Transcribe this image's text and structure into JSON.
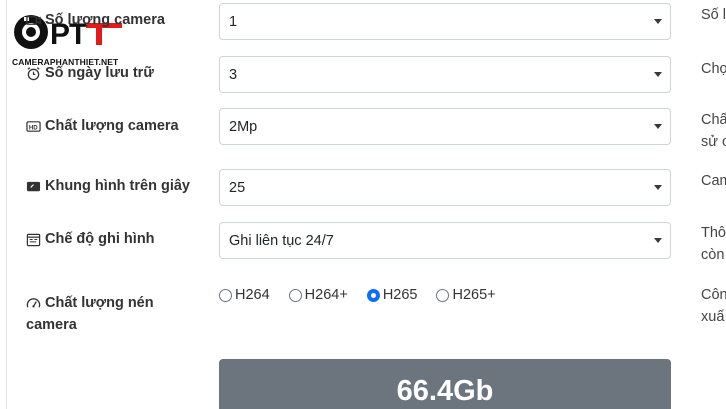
{
  "brand": {
    "logo_text": "OPT",
    "site_name": "CAMERAPHANTHIET.NET",
    "accent_color": "#e01b1b"
  },
  "form": {
    "camera_count": {
      "label": "Số lượng camera",
      "icon": "camera-icon",
      "value": "1",
      "desc": "Số l"
    },
    "storage_days": {
      "label": "Số ngày lưu trữ",
      "icon": "alarm-clock-icon",
      "value": "3",
      "desc": "Chọ"
    },
    "camera_quality": {
      "label": "Chất lượng camera",
      "icon": "hd-icon",
      "value": "2Mp",
      "desc_line1": "Chấ",
      "desc_line2": "sử c"
    },
    "frame_rate": {
      "label": "Khung hình trên giây",
      "icon": "video-frame-icon",
      "value": "25",
      "desc": "Cam"
    },
    "record_mode": {
      "label": "Chế độ ghi hình",
      "icon": "calendar-icon",
      "value": "Ghi liên tục 24/7",
      "desc_line1": "Thô",
      "desc_line2": "còn"
    },
    "compression": {
      "label_line1": "Chất lượng nén",
      "label_line2": "camera",
      "icon": "speedometer-icon",
      "options": [
        "H264",
        "H264+",
        "H265",
        "H265+"
      ],
      "selected": "H265",
      "desc_line1": "Côn",
      "desc_line2": "xuấ"
    }
  },
  "result": {
    "value": "66.4Gb"
  }
}
